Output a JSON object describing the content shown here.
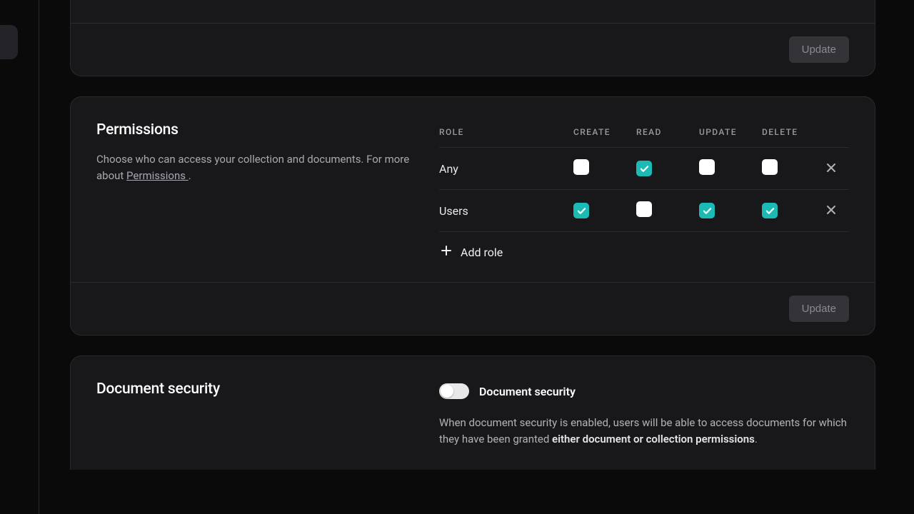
{
  "topCard": {
    "updateLabel": "Update"
  },
  "permissions": {
    "title": "Permissions",
    "descPrefix": "Choose who can access your collection and documents. For more about ",
    "descLink": "Permissions ",
    "descSuffix": ".",
    "headers": {
      "role": "ROLE",
      "create": "CREATE",
      "read": "READ",
      "update": "UPDATE",
      "delete": "DELETE"
    },
    "rows": [
      {
        "role": "Any",
        "create": false,
        "read": true,
        "update": false,
        "delete": false
      },
      {
        "role": "Users",
        "create": true,
        "read": false,
        "update": true,
        "delete": true
      }
    ],
    "addRoleLabel": "Add role",
    "updateLabel": "Update"
  },
  "docSecurity": {
    "title": "Document security",
    "toggleLabel": "Document security",
    "descPrefix": "When document security is enabled, users will be able to access documents for which they have been granted ",
    "descBold": "either document or collection permissions",
    "descSuffix": "."
  }
}
